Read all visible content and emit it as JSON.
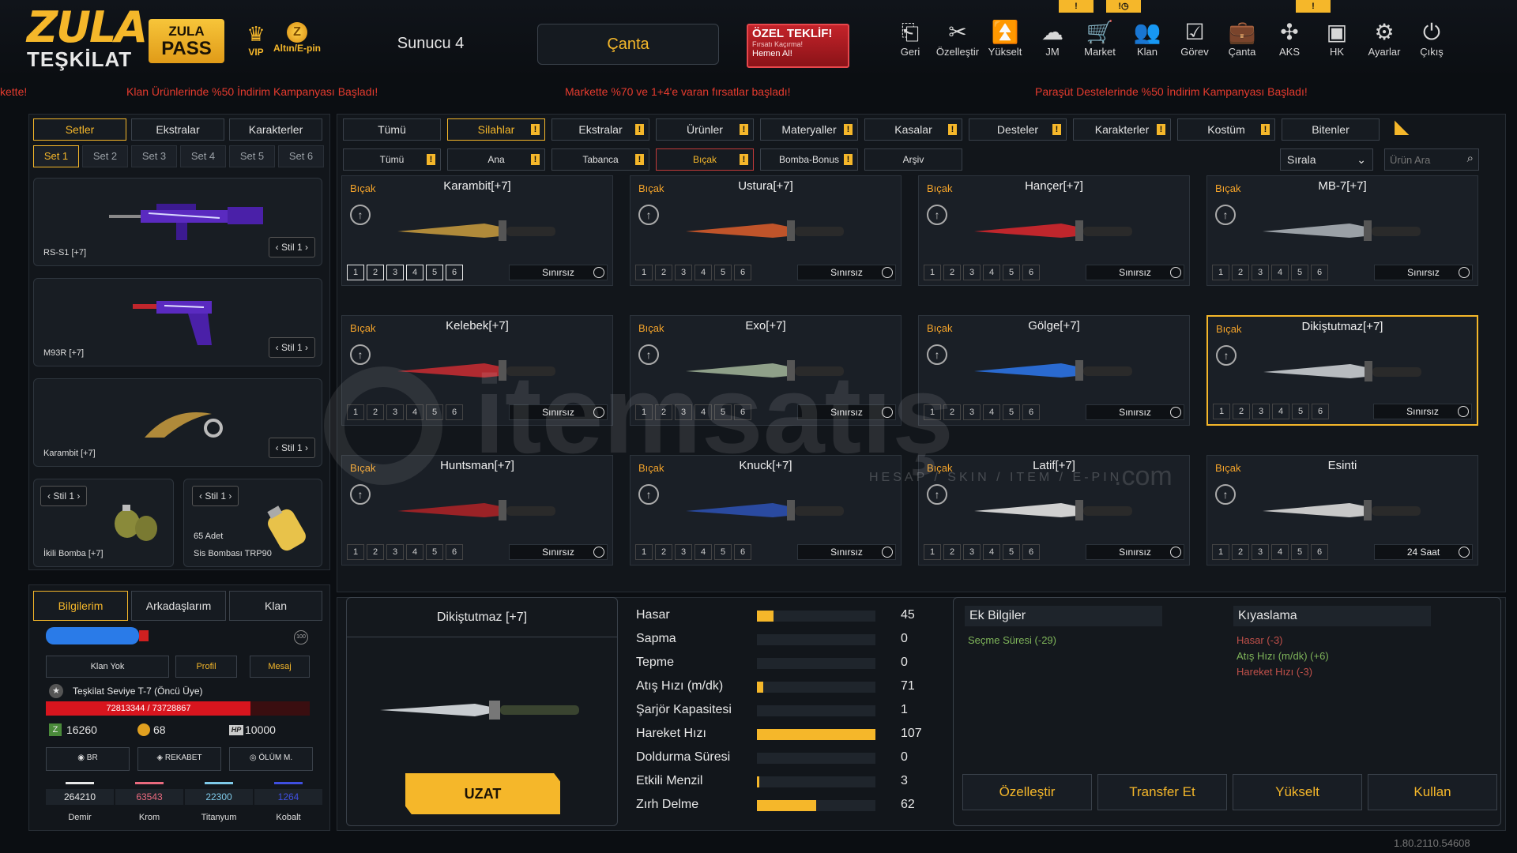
{
  "header": {
    "logo_line1": "ZULA",
    "logo_line2": "TEŞKİLAT",
    "pass_line1": "ZULA",
    "pass_line2": "PASS",
    "vip_label": "VIP",
    "altin_label": "Altın/E-pin",
    "server": "Sunucu 4",
    "canta_button": "Çanta",
    "offer_title": "ÖZEL TEKLİF!",
    "offer_sub": "Fırsatı Kaçırma!",
    "offer_cta": "Hemen Al!",
    "nav": [
      {
        "label": "Geri",
        "icon": "back-icon",
        "glyph": "⎗"
      },
      {
        "label": "Özelleştir",
        "icon": "tools-icon",
        "glyph": "✂"
      },
      {
        "label": "Yükselt",
        "icon": "upgrade-icon",
        "glyph": "⏫"
      },
      {
        "label": "JM",
        "icon": "coins-icon",
        "glyph": "☁"
      },
      {
        "label": "Market",
        "icon": "cart-icon",
        "glyph": "🛒"
      },
      {
        "label": "Klan",
        "icon": "clan-icon",
        "glyph": "👥"
      },
      {
        "label": "Görev",
        "icon": "task-icon",
        "glyph": "☑"
      },
      {
        "label": "Çanta",
        "icon": "bag-icon",
        "glyph": "💼"
      },
      {
        "label": "AKS",
        "icon": "aks-icon",
        "glyph": "✣"
      },
      {
        "label": "HK",
        "icon": "wallet-icon",
        "glyph": "▣"
      },
      {
        "label": "Ayarlar",
        "icon": "gear-icon",
        "glyph": "⚙"
      },
      {
        "label": "Çıkış",
        "icon": "power-icon",
        "glyph": "⏻"
      }
    ],
    "badges": [
      "!",
      "!◷",
      "!"
    ]
  },
  "ticker": [
    "kette!",
    "Klan Ürünlerinde %50 İndirim Kampanyası Başladı!",
    "Markette %70 ve 1+4'e varan fırsatlar başladı!",
    "Paraşüt Destelerinde %50 İndirim Kampanyası Başladı!"
  ],
  "left": {
    "tabs": [
      "Setler",
      "Ekstralar",
      "Karakterler"
    ],
    "set_tabs": [
      "Set 1",
      "Set 2",
      "Set 3",
      "Set 4",
      "Set 5",
      "Set 6"
    ],
    "slots": [
      {
        "name": "RS-S1 [+7]",
        "stil": "Stil 1"
      },
      {
        "name": "M93R [+7]",
        "stil": "Stil 1"
      },
      {
        "name": "Karambit [+7]",
        "stil": "Stil 1"
      }
    ],
    "small_slots": [
      {
        "name": "İkili Bomba [+7]",
        "stil": "Stil 1",
        "count": ""
      },
      {
        "name": "Sis Bombası TRP90",
        "stil": "Stil 1",
        "count": "65 Adet"
      }
    ]
  },
  "profile": {
    "tabs": [
      "Bilgilerim",
      "Arkadaşlarım",
      "Klan"
    ],
    "buttons": [
      "Klan Yok",
      "Profil",
      "Mesaj"
    ],
    "rank": "Teşkilat Seviye T-7 (Öncü Üye)",
    "xp": "72813344 / 73728867",
    "xp_fraction": 0.988,
    "currency": [
      {
        "icon": "z-icon",
        "glyph": "Z",
        "value": "16260"
      },
      {
        "icon": "gold-coin-icon",
        "glyph": "●",
        "value": "68"
      },
      {
        "icon": "hp-icon",
        "glyph": "HP",
        "value": "10000"
      }
    ],
    "modes": [
      "BR",
      "REKABET",
      "ÖLÜM M."
    ],
    "resources": [
      {
        "name": "Demir",
        "value": "264210",
        "color": "#e8e8e8"
      },
      {
        "name": "Krom",
        "value": "63543",
        "color": "#e96a7e"
      },
      {
        "name": "Titanyum",
        "value": "22300",
        "color": "#7ec9e8"
      },
      {
        "name": "Kobalt",
        "value": "1264",
        "color": "#3f4fe0"
      }
    ]
  },
  "main": {
    "tabs_row1": [
      "Tümü",
      "Silahlar",
      "Ekstralar",
      "Ürünler",
      "Materyaller",
      "Kasalar",
      "Desteler",
      "Karakterler",
      "Kostüm",
      "Bitenler"
    ],
    "tabs_row2": [
      "Tümü",
      "Ana",
      "Tabanca",
      "Bıçak",
      "Bomba-Bonus",
      "Arşiv"
    ],
    "sort_label": "Sırala",
    "search_placeholder": "Ürün Ara",
    "cards": [
      {
        "category": "Bıçak",
        "title": "Karambit[+7]",
        "duration": "Sınırsız",
        "color": "#b08a3a"
      },
      {
        "category": "Bıçak",
        "title": "Ustura[+7]",
        "duration": "Sınırsız",
        "color": "#c0542a"
      },
      {
        "category": "Bıçak",
        "title": "Hançer[+7]",
        "duration": "Sınırsız",
        "color": "#c0262c"
      },
      {
        "category": "Bıçak",
        "title": "MB-7[+7]",
        "duration": "Sınırsız",
        "color": "#9aa0a6"
      },
      {
        "category": "Bıçak",
        "title": "Kelebek[+7]",
        "duration": "Sınırsız",
        "color": "#b02a30"
      },
      {
        "category": "Bıçak",
        "title": "Exo[+7]",
        "duration": "Sınırsız",
        "color": "#8fa089"
      },
      {
        "category": "Bıçak",
        "title": "Gölge[+7]",
        "duration": "Sınırsız",
        "color": "#2a6ad0"
      },
      {
        "category": "Bıçak",
        "title": "Dikiştutmaz[+7]",
        "duration": "Sınırsız",
        "color": "#b8bcc0"
      },
      {
        "category": "Bıçak",
        "title": "Huntsman[+7]",
        "duration": "Sınırsız",
        "color": "#9a2226"
      },
      {
        "category": "Bıçak",
        "title": "Knuck[+7]",
        "duration": "Sınırsız",
        "color": "#2a4aa0"
      },
      {
        "category": "Bıçak",
        "title": "Latif[+7]",
        "duration": "Sınırsız",
        "color": "#d0d0d0"
      },
      {
        "category": "Bıçak",
        "title": "Esinti",
        "duration": "24 Saat",
        "color": "#c8c8c8"
      }
    ],
    "levels": [
      "1",
      "2",
      "3",
      "4",
      "5",
      "6"
    ]
  },
  "detail": {
    "title": "Dikiştutmaz [+7]",
    "extend_button": "UZAT",
    "stats": [
      {
        "label": "Hasar",
        "value": "45",
        "fraction": 0.14
      },
      {
        "label": "Sapma",
        "value": "0",
        "fraction": 0
      },
      {
        "label": "Tepme",
        "value": "0",
        "fraction": 0
      },
      {
        "label": "Atış Hızı (m/dk)",
        "value": "71",
        "fraction": 0.05
      },
      {
        "label": "Şarjör Kapasitesi",
        "value": "1",
        "fraction": 0
      },
      {
        "label": "Hareket Hızı",
        "value": "107",
        "fraction": 1
      },
      {
        "label": "Doldurma Süresi",
        "value": "0",
        "fraction": 0
      },
      {
        "label": "Etkili Menzil",
        "value": "3",
        "fraction": 0.02
      },
      {
        "label": "Zırh Delme",
        "value": "62",
        "fraction": 0.5
      }
    ],
    "extra_title": "Ek Bilgiler",
    "extra_items": [
      "Seçme Süresi (-29)"
    ],
    "compare_title": "Kıyaslama",
    "compare_items": [
      {
        "text": "Hasar (-3)",
        "color": "#c0504a"
      },
      {
        "text": "Atış Hızı (m/dk) (+6)",
        "color": "#7fb55a"
      },
      {
        "text": "Hareket Hızı (-3)",
        "color": "#c0504a"
      }
    ],
    "actions": [
      "Özelleştir",
      "Transfer Et",
      "Yükselt",
      "Kullan"
    ]
  },
  "watermark": {
    "brand": "itemsatış",
    "tagline": "HESAP / SKIN / ITEM / E-PIN",
    "suffix": ".com"
  },
  "version": "1.80.2110.54608"
}
